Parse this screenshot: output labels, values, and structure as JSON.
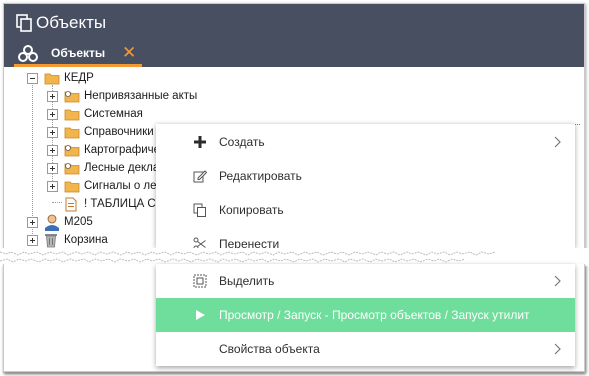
{
  "window": {
    "title": "Объекты"
  },
  "tab": {
    "label": "Объекты",
    "close_glyph": "✕"
  },
  "tree": {
    "root": {
      "label": "КЕДР"
    },
    "children": [
      {
        "label": "Непривязанные акты"
      },
      {
        "label": "Системная"
      },
      {
        "label": "Справочники"
      },
      {
        "label": "Картографиче"
      },
      {
        "label": "Лесные декла"
      },
      {
        "label": "Сигналы о лес"
      },
      {
        "label": "! ТАБЛИЦА СИ"
      }
    ],
    "siblings": [
      {
        "label": "М205"
      },
      {
        "label": "Корзина"
      }
    ]
  },
  "context_menu": {
    "items": [
      {
        "label": "Создать",
        "icon": "plus-icon",
        "submenu": true
      },
      {
        "label": "Редактировать",
        "icon": "edit-icon",
        "submenu": false
      },
      {
        "label": "Копировать",
        "icon": "copy-icon",
        "submenu": false
      },
      {
        "label": "Перенести",
        "icon": "scissors-icon",
        "submenu": false
      },
      {
        "label": "Выделить",
        "icon": "select-icon",
        "submenu": true
      },
      {
        "label": "Просмотр / Запуск - Просмотр объектов / Запуск утилит",
        "icon": "play-icon",
        "submenu": false,
        "highlighted": true
      },
      {
        "label": "Свойства объекта",
        "icon": "",
        "submenu": true
      }
    ]
  },
  "colors": {
    "titlebar": "#484f61",
    "tab_accent": "#f39a33",
    "highlight": "#6fdd9b",
    "folder": "#f2b44d"
  }
}
